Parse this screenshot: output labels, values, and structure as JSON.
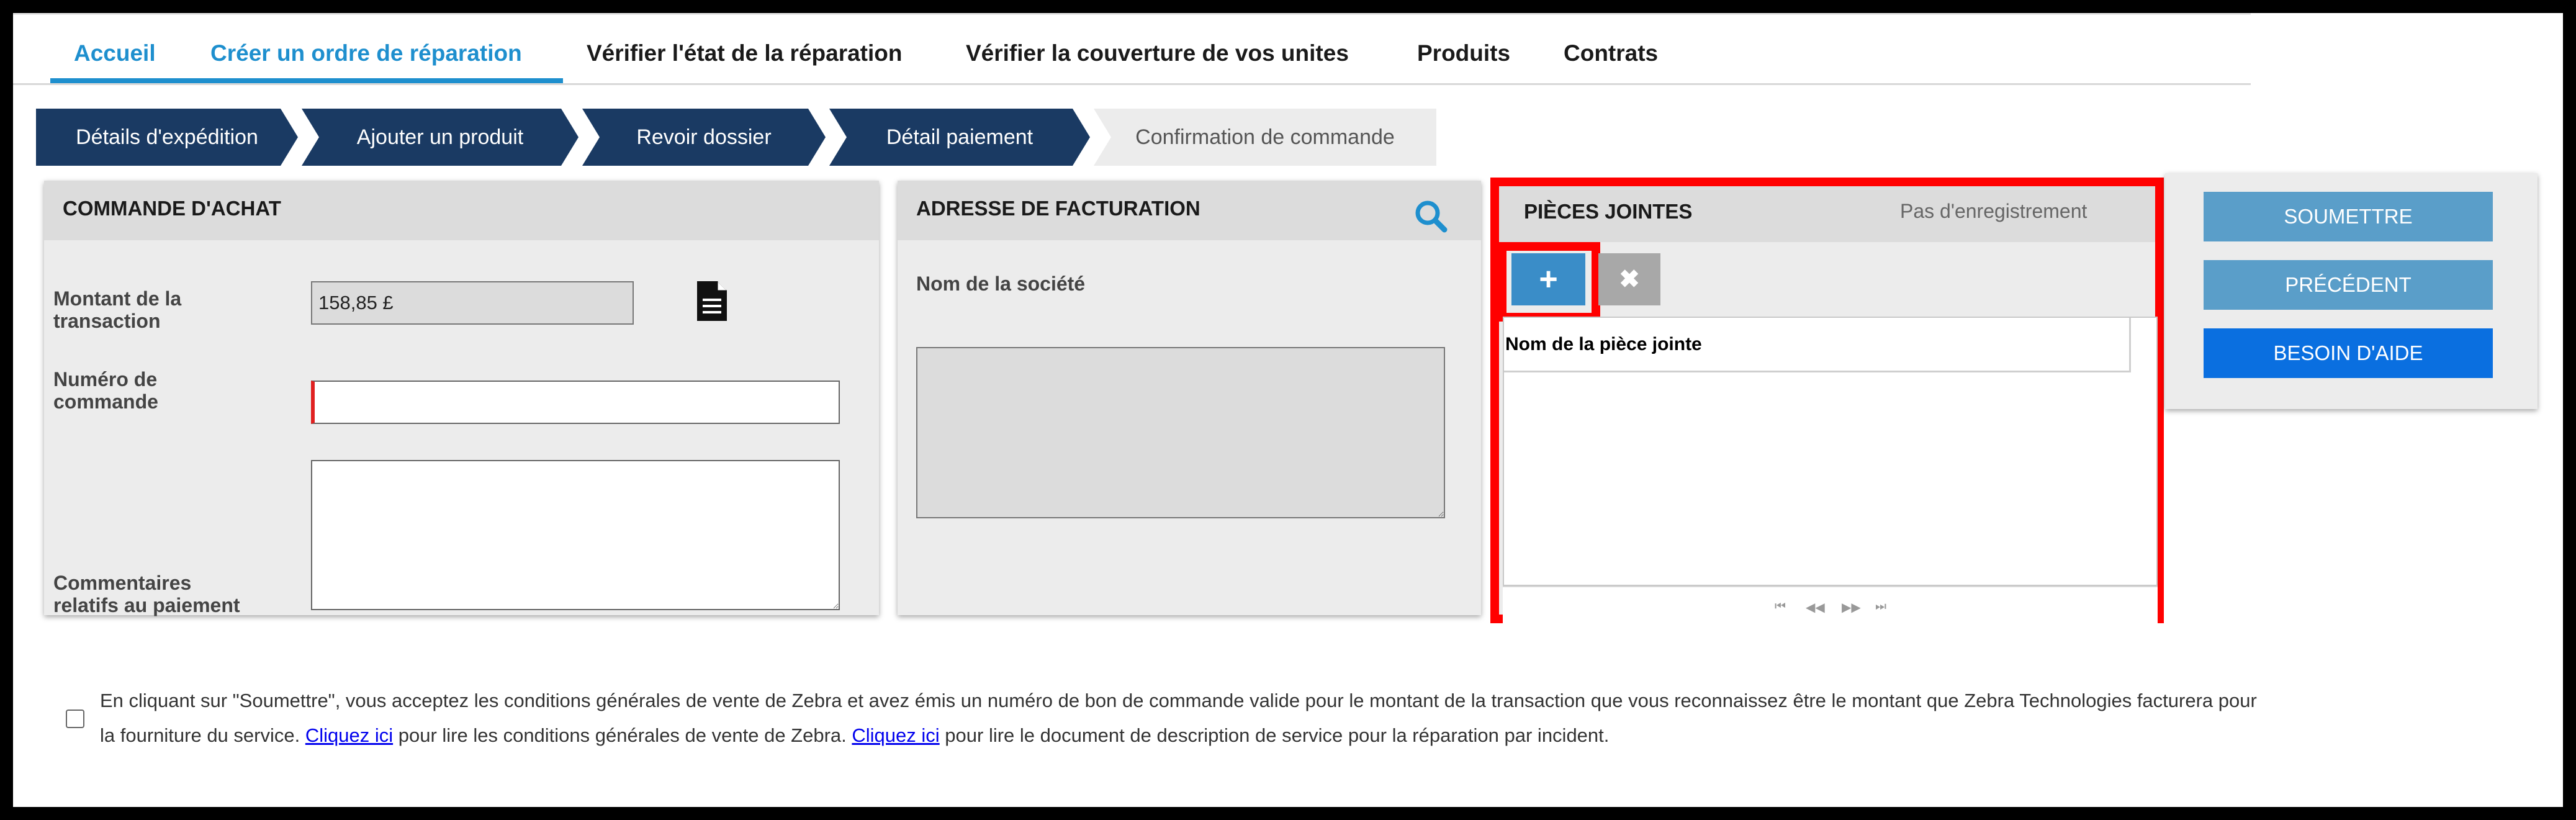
{
  "nav": {
    "items": [
      "Accueil",
      "Créer un ordre de réparation",
      "Vérifier l'état de la réparation",
      "Vérifier la couverture de vos unites",
      "Produits",
      "Contrats"
    ]
  },
  "wizard": {
    "steps": [
      "Détails d'expédition",
      "Ajouter un produit",
      "Revoir dossier",
      "Détail paiement",
      "Confirmation de commande"
    ]
  },
  "purchase_order": {
    "title": "COMMANDE D'ACHAT",
    "amount_label_1": "Montant de la",
    "amount_label_2": "transaction",
    "amount_value": "158,85 £",
    "order_label_1": "Numéro de",
    "order_label_2": "commande",
    "order_value": "",
    "comments_label_1": "Commentaires",
    "comments_label_2": "relatifs au paiement",
    "comments_value": ""
  },
  "billing": {
    "title": "ADRESSE DE FACTURATION",
    "company_label": "Nom de la société",
    "address_value": ""
  },
  "attachments": {
    "title": "PIÈCES JOINTES",
    "status": "Pas d'enregistrement",
    "add_label": "+",
    "remove_label": "✖",
    "column_header": "Nom de la pièce jointe",
    "pager": [
      "⏮",
      "◀◀",
      "▶▶",
      "⏭"
    ]
  },
  "actions": {
    "submit": "SOUMETTRE",
    "previous": "PRÉCÉDENT",
    "help": "BESOIN D'AIDE"
  },
  "terms": {
    "part1": "En cliquant sur \"Soumettre\", vous acceptez les conditions générales de vente de Zebra et avez émis un numéro de bon de commande valide pour le montant de la transaction que vous reconnaissez être le montant que Zebra Technologies facturera pour la fourniture du service. ",
    "link1": "Cliquez ici",
    "part2": " pour lire les conditions générales de vente de Zebra. ",
    "link2": "Cliquez ici",
    "part3": " pour lire le document de description de service pour la réparation par incident."
  },
  "colors": {
    "nav_active": "#1e8fce",
    "wizard_step": "#1a3a63",
    "highlight": "#ff0000",
    "button_primary": "#5a9ec9",
    "button_help": "#0a6fe0"
  }
}
